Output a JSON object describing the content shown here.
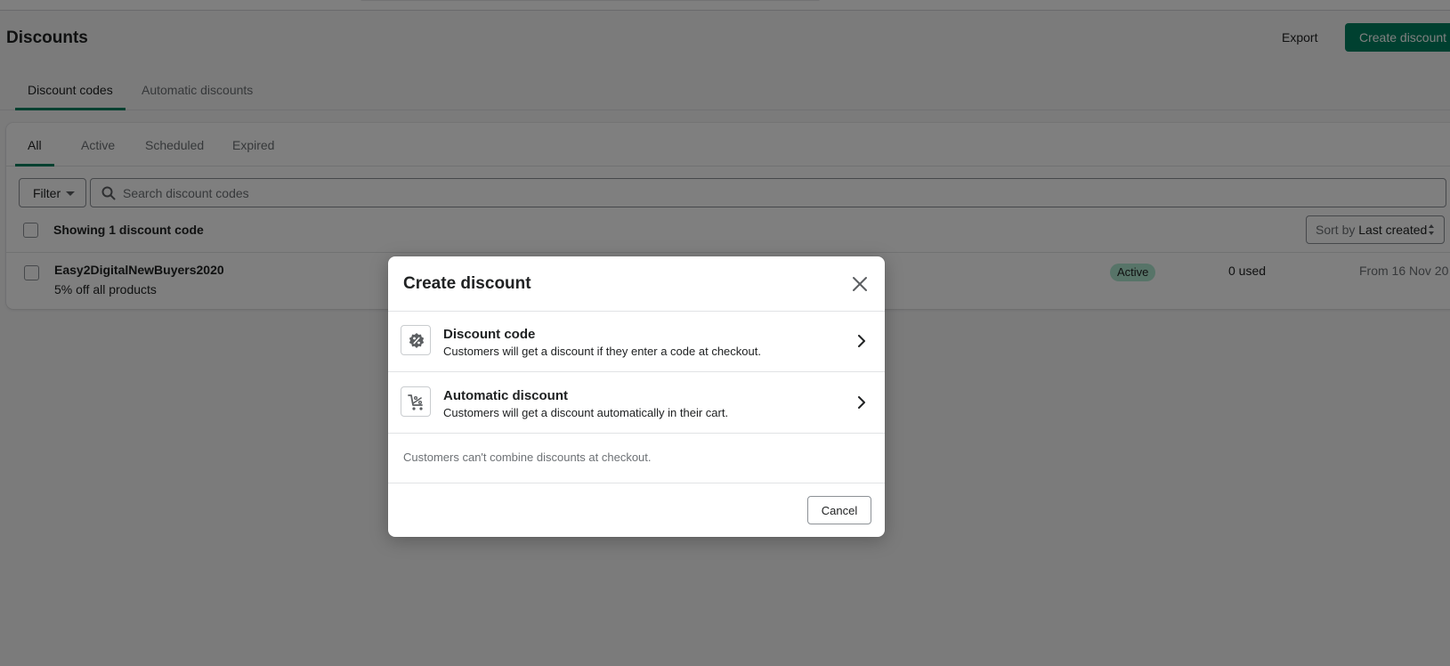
{
  "page": {
    "title": "Discounts",
    "export_label": "Export",
    "create_label": "Create discount"
  },
  "main_tabs": [
    {
      "label": "Discount codes",
      "active": true
    },
    {
      "label": "Automatic discounts",
      "active": false
    }
  ],
  "status_tabs": [
    {
      "label": "All",
      "active": true
    },
    {
      "label": "Active",
      "active": false
    },
    {
      "label": "Scheduled",
      "active": false
    },
    {
      "label": "Expired",
      "active": false
    }
  ],
  "filter": {
    "label": "Filter",
    "search_placeholder": "Search discount codes"
  },
  "list": {
    "showing": "Showing 1 discount code",
    "sort_label": "Sort by",
    "sort_value": "Last created",
    "rows": [
      {
        "name": "Easy2DigitalNewBuyers2020",
        "description": "5% off all products",
        "status": "Active",
        "used": "0 used",
        "date": "From 16 Nov 20"
      }
    ]
  },
  "modal": {
    "title": "Create discount",
    "options": [
      {
        "icon": "discount-badge-icon",
        "title": "Discount code",
        "description": "Customers will get a discount if they enter a code at checkout."
      },
      {
        "icon": "cart-discount-icon",
        "title": "Automatic discount",
        "description": "Customers will get a discount automatically in their cart."
      }
    ],
    "note": "Customers can't combine discounts at checkout.",
    "cancel_label": "Cancel"
  },
  "colors": {
    "brand": "#008060",
    "badge_active": "#aee9d1",
    "overlay": "rgba(0,0,0,0.5)"
  }
}
